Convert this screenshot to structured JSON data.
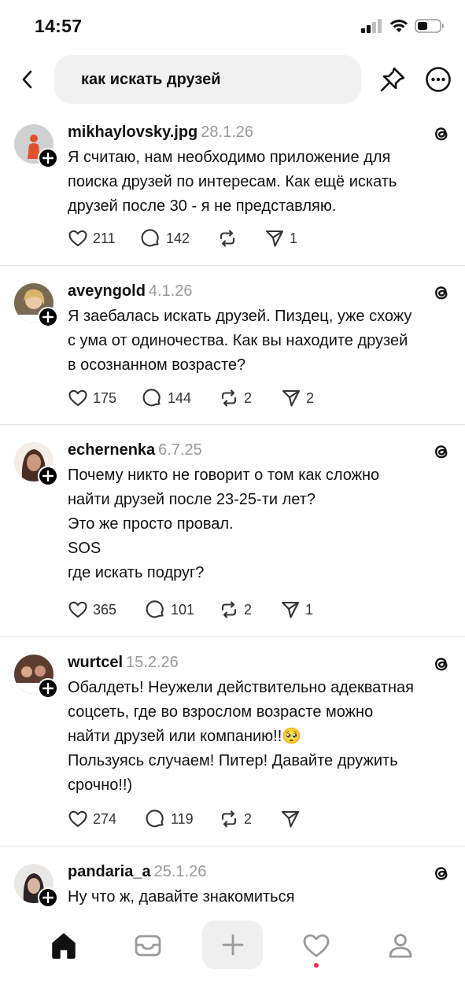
{
  "status_bar": {
    "time": "14:57"
  },
  "header": {
    "search_query": "как искать друзей"
  },
  "posts": [
    {
      "username": "mikhaylovsky.jpg",
      "date": "28.1.26",
      "lines": [
        "Я считаю, нам необходимо приложение для",
        "поиска друзей по интересам. Как ещё искать",
        "друзей после 30 - я не представляю."
      ],
      "likes": "211",
      "replies": "142",
      "reposts": "",
      "shares": "1",
      "avatar_color": "#c9cbcf"
    },
    {
      "username": "aveyngold",
      "date": "4.1.26",
      "lines": [
        "Я заебалась искать друзей. Пиздец, уже схожу",
        "с ума от одиночества. Как вы находите друзей",
        "в осознанном возрасте?"
      ],
      "likes": "175",
      "replies": "144",
      "reposts": "2",
      "shares": "2",
      "avatar_color": "#8c7a5e"
    },
    {
      "username": "echernenka",
      "date": "6.7.25",
      "lines": [
        "Почему никто не говорит о том как сложно",
        "найти друзей после 23-25-ти лет?",
        "Это же просто провал.",
        "SOS",
        "где искать подруг?"
      ],
      "likes": "365",
      "replies": "101",
      "reposts": "2",
      "shares": "1",
      "avatar_color": "#5a3b2e"
    },
    {
      "username": "wurtcel",
      "date": "15.2.26",
      "lines": [
        "Обалдеть! Неужели действительно адекватная",
        "соцсеть, где во взрослом возрасте можно",
        "найти друзей или компанию!!🥺",
        "Пользуясь случаем! Питер! Давайте дружить",
        "срочно!!)"
      ],
      "likes": "274",
      "replies": "119",
      "reposts": "2",
      "shares": "",
      "avatar_color": "#6e4a3a"
    },
    {
      "username": "pandaria_a",
      "date": "25.1.26",
      "lines": [
        "Ну что ж, давайте знакомиться"
      ],
      "likes": "",
      "replies": "",
      "reposts": "",
      "shares": "",
      "avatar_color": "#3a2f33"
    }
  ]
}
